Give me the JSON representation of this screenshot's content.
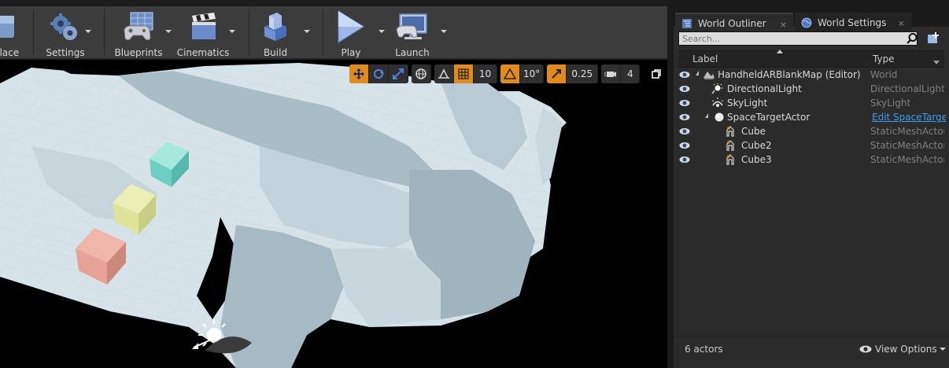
{
  "toolbar": {
    "buttons": [
      {
        "label": "place",
        "icon": "place-actor-icon"
      },
      {
        "label": "Settings",
        "icon": "gears-icon"
      },
      {
        "label": "Blueprints",
        "icon": "blueprints-controller-icon"
      },
      {
        "label": "Cinematics",
        "icon": "clapperboard-icon"
      },
      {
        "label": "Build",
        "icon": "build-blocks-icon"
      },
      {
        "label": "Play",
        "icon": "play-triangle-icon"
      },
      {
        "label": "Launch",
        "icon": "launch-monitor-icon"
      }
    ]
  },
  "viewport": {
    "grid_snap": "10",
    "rotation_snap": "10°",
    "scale_snap": "0.25",
    "camera_speed": "4"
  },
  "tabs": [
    {
      "label": "World Outliner",
      "active": true,
      "close": "×"
    },
    {
      "label": "World Settings",
      "active": false,
      "close": "×"
    }
  ],
  "outliner": {
    "search_placeholder": "Search...",
    "col_label": "Label",
    "col_type": "Type",
    "rows": [
      {
        "name": "HandheldARBlankMap (Editor)",
        "type": "World",
        "icon": "world-icon",
        "depth": 0,
        "expanded": true
      },
      {
        "name": "DirectionalLight",
        "type": "DirectionalLight",
        "icon": "directional-light-icon",
        "depth": 1
      },
      {
        "name": "SkyLight",
        "type": "SkyLight",
        "icon": "skylight-icon",
        "depth": 1
      },
      {
        "name": "SpaceTargetActor",
        "type": "Edit SpaceTargetActor",
        "icon": "sphere-actor-icon",
        "depth": 1,
        "expanded": true,
        "type_is_link": true
      },
      {
        "name": "Cube",
        "type": "StaticMeshActor",
        "icon": "static-mesh-icon",
        "depth": 2
      },
      {
        "name": "Cube2",
        "type": "StaticMeshActor",
        "icon": "static-mesh-icon",
        "depth": 2
      },
      {
        "name": "Cube3",
        "type": "StaticMeshActor",
        "icon": "static-mesh-icon",
        "depth": 2
      }
    ],
    "actor_count": "6 actors",
    "view_options": "View Options"
  },
  "colors": {
    "toolbar_bg": "#3c3c3c",
    "panel_bg": "#2b2b2b",
    "accent_orange": "#e08b1c",
    "link_blue": "#3a9ff0",
    "mesh_surface": "#d4e2e8",
    "cube_teal": "#7fd6cc",
    "cube_yellow": "#dde49a",
    "cube_salmon": "#e6a294"
  }
}
